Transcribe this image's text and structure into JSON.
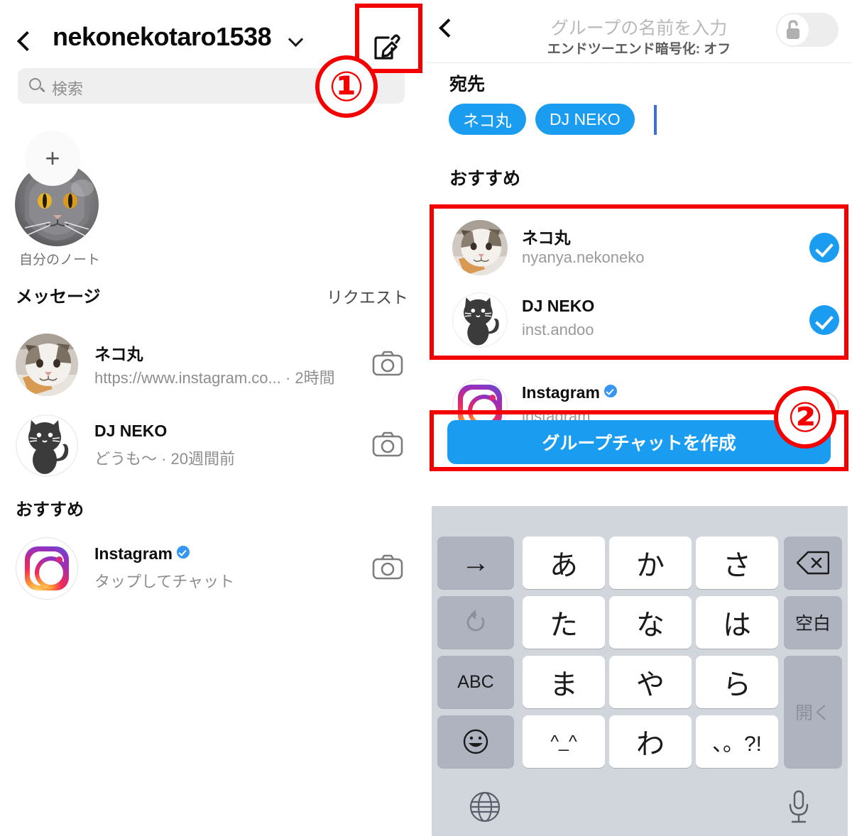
{
  "left_panel": {
    "header": {
      "back_icon": "chevron-left-icon",
      "username": "nekonekotaro1538",
      "caret_icon": "chevron-down-icon",
      "compose_icon": "compose-pencil-icon"
    },
    "search": {
      "placeholder": "検索",
      "icon": "search-icon"
    },
    "note": {
      "plus_icon": "plus-icon",
      "label": "自分のノート",
      "avatar": "gray-scottish-fold-cat"
    },
    "messages_section": {
      "title": "メッセージ",
      "requests_link": "リクエスト"
    },
    "conversations": [
      {
        "name": "ネコ丸",
        "preview": "https://www.instagram.co... · 2時間",
        "avatar": "calico-kitten",
        "camera_icon": "camera-icon"
      },
      {
        "name": "DJ NEKO",
        "preview": "どうも〜 · 20週間前",
        "avatar": "black-cat-illustration",
        "camera_icon": "camera-icon"
      }
    ],
    "suggested_section": {
      "title": "おすすめ"
    },
    "suggested": [
      {
        "name": "Instagram",
        "verified": true,
        "preview": "タップしてチャット",
        "avatar": "instagram-logo",
        "camera_icon": "camera-icon"
      }
    ]
  },
  "right_panel": {
    "header": {
      "back_icon": "chevron-left-icon",
      "group_name_placeholder": "グループの名前を入力",
      "encryption_status": "エンドツーエンド暗号化: オフ",
      "toggle_icon": "unlocked-padlock-icon",
      "toggle_state": "off"
    },
    "to_label": "宛先",
    "chips": [
      "ネコ丸",
      "DJ NEKO"
    ],
    "suggested_title": "おすすめ",
    "suggested": [
      {
        "name": "ネコ丸",
        "username": "nyanya.nekoneko",
        "avatar": "calico-kitten",
        "selected": true
      },
      {
        "name": "DJ NEKO",
        "username": "inst.andoo",
        "avatar": "black-cat-illustration",
        "selected": true
      },
      {
        "name": "Instagram",
        "username": "instagram",
        "avatar": "instagram-logo",
        "verified": true,
        "selected": false
      }
    ],
    "create_button": "グループチャットを作成"
  },
  "keyboard": {
    "rows": [
      [
        {
          "label": "→",
          "style": "gray",
          "name": "cursor-right-key"
        },
        {
          "label": "あ",
          "style": "white",
          "name": "a-kana-key"
        },
        {
          "label": "か",
          "style": "white",
          "name": "ka-kana-key"
        },
        {
          "label": "さ",
          "style": "white",
          "name": "sa-kana-key"
        },
        {
          "label": "⌫",
          "style": "gray",
          "name": "backspace-key"
        }
      ],
      [
        {
          "label": "↺",
          "style": "gray",
          "name": "undo-key"
        },
        {
          "label": "た",
          "style": "white",
          "name": "ta-kana-key"
        },
        {
          "label": "な",
          "style": "white",
          "name": "na-kana-key"
        },
        {
          "label": "は",
          "style": "white",
          "name": "ha-kana-key"
        },
        {
          "label": "空白",
          "style": "gray",
          "name": "space-key"
        }
      ],
      [
        {
          "label": "ABC",
          "style": "gray",
          "name": "abc-key"
        },
        {
          "label": "ま",
          "style": "white",
          "name": "ma-kana-key"
        },
        {
          "label": "や",
          "style": "white",
          "name": "ya-kana-key"
        },
        {
          "label": "ら",
          "style": "white",
          "name": "ra-kana-key"
        },
        {
          "label": "開く",
          "style": "gray",
          "name": "open-key"
        }
      ],
      [
        {
          "label": "☺",
          "style": "gray",
          "name": "emoji-key"
        },
        {
          "label": "^_^",
          "style": "white",
          "name": "kaomoji-key"
        },
        {
          "label": "わ",
          "style": "white",
          "name": "wa-kana-key"
        },
        {
          "label": "、。?!",
          "style": "white",
          "name": "punctuation-key"
        }
      ]
    ],
    "bottom": {
      "globe_icon": "globe-icon",
      "mic_icon": "microphone-icon"
    }
  },
  "annotations": {
    "step1": "①",
    "step2": "②",
    "color": "#f40000"
  }
}
